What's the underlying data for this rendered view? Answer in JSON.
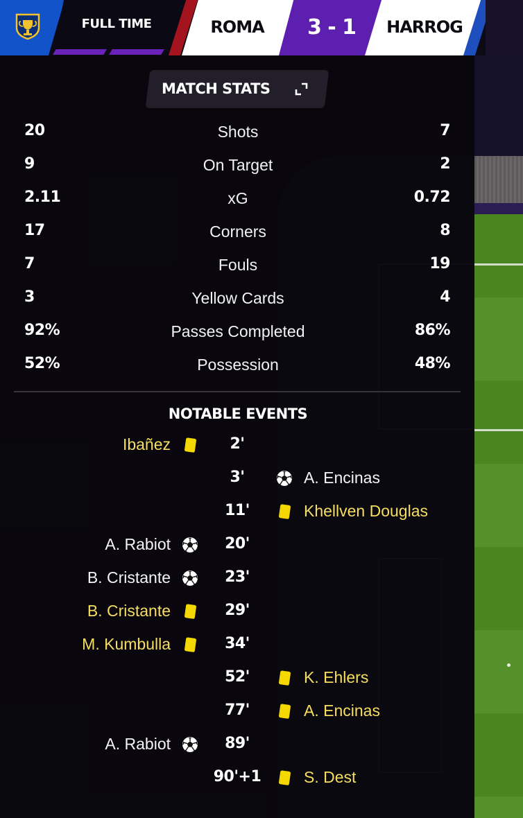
{
  "header": {
    "competition_icon": "trophy-shield-icon",
    "status": "FULL TIME",
    "home_team": "ROMA",
    "score": "3 - 1",
    "away_team": "HARROG",
    "colors": {
      "home": "#a3141e",
      "away": "#1f4fbf",
      "score_bg": "#5d1fb0",
      "logo_bg": "#1253c9"
    }
  },
  "match_stats": {
    "title": "MATCH STATS",
    "expand_icon": "expand-icon",
    "rows": [
      {
        "home": "20",
        "label": "Shots",
        "away": "7"
      },
      {
        "home": "9",
        "label": "On Target",
        "away": "2"
      },
      {
        "home": "2.11",
        "label": "xG",
        "away": "0.72"
      },
      {
        "home": "17",
        "label": "Corners",
        "away": "8"
      },
      {
        "home": "7",
        "label": "Fouls",
        "away": "19"
      },
      {
        "home": "3",
        "label": "Yellow Cards",
        "away": "4"
      },
      {
        "home": "92%",
        "label": "Passes Completed",
        "away": "86%"
      },
      {
        "home": "52%",
        "label": "Possession",
        "away": "48%"
      }
    ]
  },
  "notable_events": {
    "title": "NOTABLE EVENTS",
    "colors": {
      "yellow_card": "#f6de60",
      "goal_text": "#f4f4f4"
    },
    "items": [
      {
        "minute": "2'",
        "side": "home",
        "player": "Ibañez",
        "type": "yellow-card"
      },
      {
        "minute": "3'",
        "side": "away",
        "player": "A. Encinas",
        "type": "goal"
      },
      {
        "minute": "11'",
        "side": "away",
        "player": "Khellven Douglas",
        "type": "yellow-card"
      },
      {
        "minute": "20'",
        "side": "home",
        "player": "A. Rabiot",
        "type": "goal"
      },
      {
        "minute": "23'",
        "side": "home",
        "player": "B. Cristante",
        "type": "goal"
      },
      {
        "minute": "29'",
        "side": "home",
        "player": "B. Cristante",
        "type": "yellow-card"
      },
      {
        "minute": "34'",
        "side": "home",
        "player": "M. Kumbulla",
        "type": "yellow-card"
      },
      {
        "minute": "52'",
        "side": "away",
        "player": "K. Ehlers",
        "type": "yellow-card"
      },
      {
        "minute": "77'",
        "side": "away",
        "player": "A. Encinas",
        "type": "yellow-card"
      },
      {
        "minute": "89'",
        "side": "home",
        "player": "A. Rabiot",
        "type": "goal"
      },
      {
        "minute": "90'+1",
        "side": "away",
        "player": "S. Dest",
        "type": "yellow-card"
      }
    ]
  }
}
